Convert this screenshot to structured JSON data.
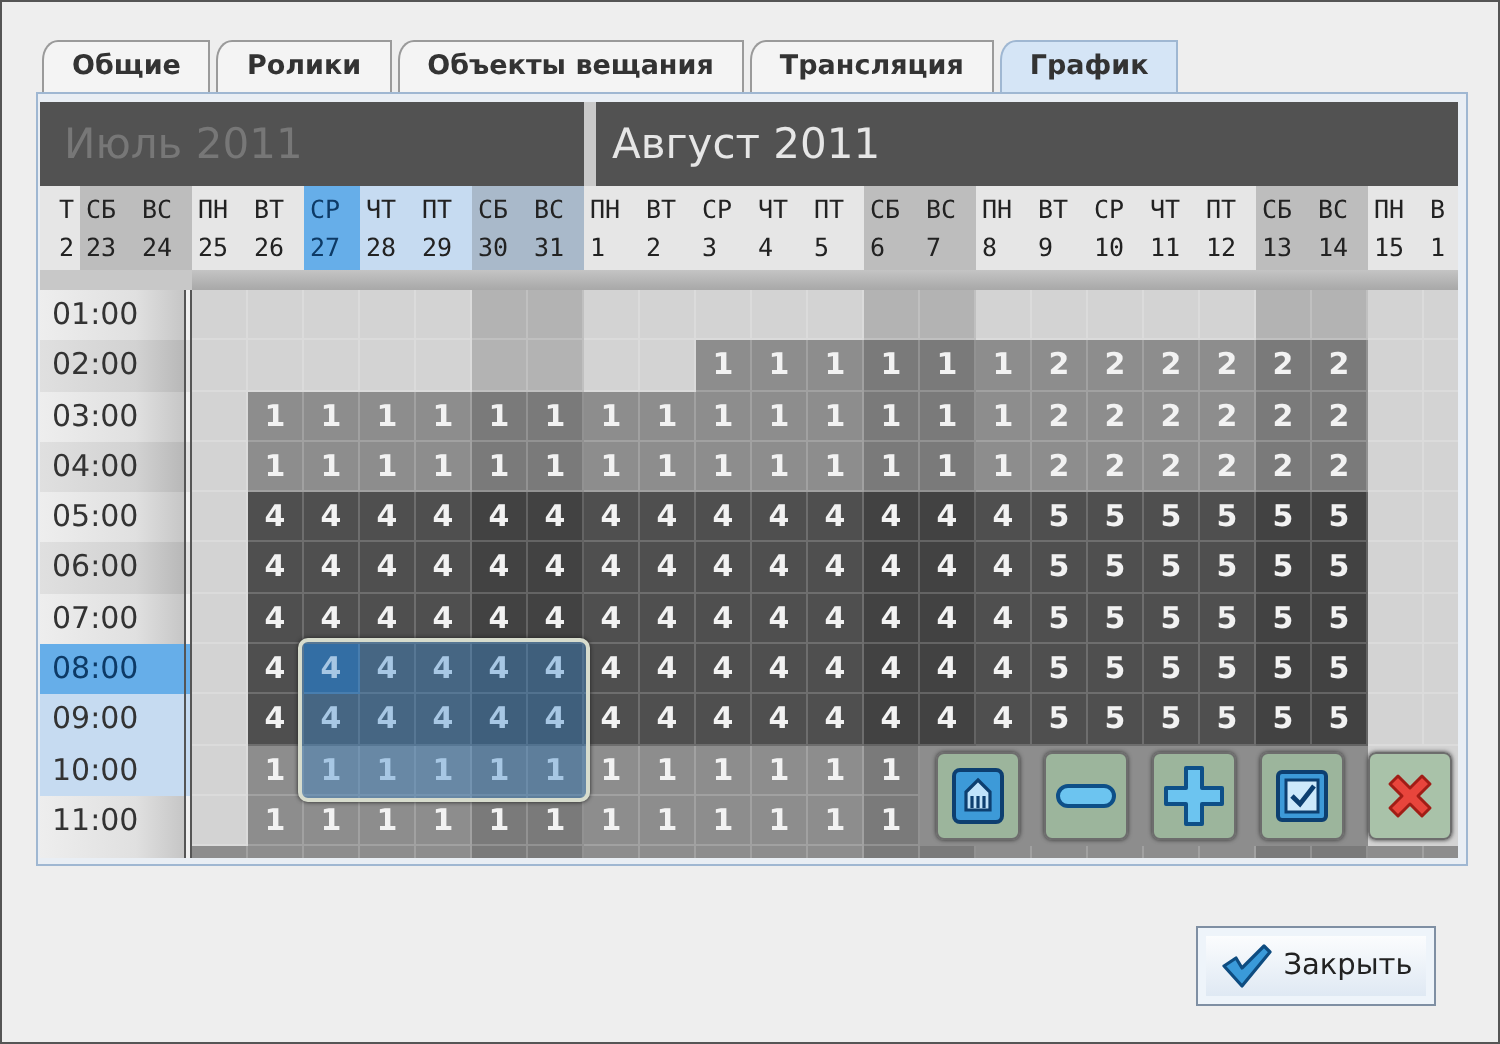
{
  "tabs": [
    {
      "label": "Общие",
      "selected": false
    },
    {
      "label": "Ролики",
      "selected": false
    },
    {
      "label": "Объекты вещания",
      "selected": false
    },
    {
      "label": "Трансляция",
      "selected": false
    },
    {
      "label": "График",
      "selected": true
    }
  ],
  "months": [
    {
      "name": "Июль 2011",
      "selected": false,
      "days": [
        {
          "weekday": "Т",
          "date": "2",
          "weekend": false,
          "selected": false,
          "cursor": false
        },
        {
          "weekday": "СБ",
          "date": "23",
          "weekend": true,
          "selected": false,
          "cursor": false
        },
        {
          "weekday": "ВС",
          "date": "24",
          "weekend": true,
          "selected": false,
          "cursor": false
        },
        {
          "weekday": "ПН",
          "date": "25",
          "weekend": false,
          "selected": false,
          "cursor": false
        },
        {
          "weekday": "ВТ",
          "date": "26",
          "weekend": false,
          "selected": false,
          "cursor": false
        },
        {
          "weekday": "СР",
          "date": "27",
          "weekend": false,
          "selected": true,
          "cursor": true
        },
        {
          "weekday": "ЧТ",
          "date": "28",
          "weekend": false,
          "selected": true,
          "cursor": false
        },
        {
          "weekday": "ПТ",
          "date": "29",
          "weekend": false,
          "selected": true,
          "cursor": false
        },
        {
          "weekday": "СБ",
          "date": "30",
          "weekend": true,
          "selected": true,
          "cursor": false
        },
        {
          "weekday": "ВС",
          "date": "31",
          "weekend": true,
          "selected": true,
          "cursor": false
        }
      ]
    },
    {
      "name": "Август 2011",
      "selected": true,
      "days": [
        {
          "weekday": "ПН",
          "date": "1",
          "weekend": false,
          "selected": false,
          "cursor": false
        },
        {
          "weekday": "ВТ",
          "date": "2",
          "weekend": false,
          "selected": false,
          "cursor": false
        },
        {
          "weekday": "СР",
          "date": "3",
          "weekend": false,
          "selected": false,
          "cursor": false
        },
        {
          "weekday": "ЧТ",
          "date": "4",
          "weekend": false,
          "selected": false,
          "cursor": false
        },
        {
          "weekday": "ПТ",
          "date": "5",
          "weekend": false,
          "selected": false,
          "cursor": false
        },
        {
          "weekday": "СБ",
          "date": "6",
          "weekend": true,
          "selected": false,
          "cursor": false
        },
        {
          "weekday": "ВС",
          "date": "7",
          "weekend": true,
          "selected": false,
          "cursor": false
        },
        {
          "weekday": "ПН",
          "date": "8",
          "weekend": false,
          "selected": false,
          "cursor": false
        },
        {
          "weekday": "ВТ",
          "date": "9",
          "weekend": false,
          "selected": false,
          "cursor": false
        },
        {
          "weekday": "СР",
          "date": "10",
          "weekend": false,
          "selected": false,
          "cursor": false
        },
        {
          "weekday": "ЧТ",
          "date": "11",
          "weekend": false,
          "selected": false,
          "cursor": false
        },
        {
          "weekday": "ПТ",
          "date": "12",
          "weekend": false,
          "selected": false,
          "cursor": false
        },
        {
          "weekday": "СБ",
          "date": "13",
          "weekend": true,
          "selected": false,
          "cursor": false
        },
        {
          "weekday": "ВС",
          "date": "14",
          "weekend": true,
          "selected": false,
          "cursor": false
        },
        {
          "weekday": "ПН",
          "date": "15",
          "weekend": false,
          "selected": false,
          "cursor": false
        },
        {
          "weekday": "В",
          "date": "1",
          "weekend": false,
          "selected": false,
          "cursor": false
        }
      ]
    }
  ],
  "rows": [
    {
      "time": "01:00",
      "selected": false,
      "cursor": false
    },
    {
      "time": "02:00",
      "kind": "mid",
      "selected": false,
      "cursor": false,
      "cells": [
        null,
        null,
        null,
        null,
        null,
        null,
        null,
        null,
        null,
        "1",
        "1",
        "1",
        "1",
        "1",
        "1",
        "2",
        "2",
        "2",
        "2",
        "2",
        "2"
      ]
    },
    {
      "time": "03:00",
      "kind": "mid",
      "selected": false,
      "cursor": false,
      "cells": [
        null,
        "1",
        "1",
        "1",
        "1",
        "1",
        "1",
        "1",
        "1",
        "1",
        "1",
        "1",
        "1",
        "1",
        "1",
        "2",
        "2",
        "2",
        "2",
        "2",
        "2"
      ]
    },
    {
      "time": "04:00",
      "kind": "mid",
      "selected": false,
      "cursor": false,
      "cells": [
        null,
        "1",
        "1",
        "1",
        "1",
        "1",
        "1",
        "1",
        "1",
        "1",
        "1",
        "1",
        "1",
        "1",
        "1",
        "2",
        "2",
        "2",
        "2",
        "2",
        "2"
      ]
    },
    {
      "time": "05:00",
      "kind": "dark",
      "selected": false,
      "cursor": false,
      "cells": [
        null,
        "4",
        "4",
        "4",
        "4",
        "4",
        "4",
        "4",
        "4",
        "4",
        "4",
        "4",
        "4",
        "4",
        "4",
        "5",
        "5",
        "5",
        "5",
        "5",
        "5"
      ]
    },
    {
      "time": "06:00",
      "kind": "dark",
      "selected": false,
      "cursor": false,
      "cells": [
        null,
        "4",
        "4",
        "4",
        "4",
        "4",
        "4",
        "4",
        "4",
        "4",
        "4",
        "4",
        "4",
        "4",
        "4",
        "5",
        "5",
        "5",
        "5",
        "5",
        "5"
      ]
    },
    {
      "time": "07:00",
      "kind": "dark",
      "selected": false,
      "cursor": false,
      "cells": [
        null,
        "4",
        "4",
        "4",
        "4",
        "4",
        "4",
        "4",
        "4",
        "4",
        "4",
        "4",
        "4",
        "4",
        "4",
        "5",
        "5",
        "5",
        "5",
        "5",
        "5"
      ]
    },
    {
      "time": "08:00",
      "kind": "dark",
      "selected": true,
      "cursor": true,
      "cells": [
        null,
        "4",
        "4",
        "4",
        "4",
        "4",
        "4",
        "4",
        "4",
        "4",
        "4",
        "4",
        "4",
        "4",
        "4",
        "5",
        "5",
        "5",
        "5",
        "5",
        "5"
      ]
    },
    {
      "time": "09:00",
      "kind": "dark",
      "selected": true,
      "cursor": false,
      "cells": [
        null,
        "4",
        "4",
        "4",
        "4",
        "4",
        "4",
        "4",
        "4",
        "4",
        "4",
        "4",
        "4",
        "4",
        "4",
        "5",
        "5",
        "5",
        "5",
        "5",
        "5"
      ]
    },
    {
      "time": "10:00",
      "kind": "mid",
      "selected": true,
      "cursor": false,
      "cells": [
        null,
        "1",
        "1",
        "1",
        "1",
        "1",
        "1",
        "1",
        "1",
        "1",
        "1",
        "1",
        "1"
      ]
    },
    {
      "time": "11:00",
      "kind": "mid",
      "selected": false,
      "cursor": false,
      "cells": [
        null,
        "1",
        "1",
        "1",
        "1",
        "1",
        "1",
        "1",
        "1",
        "1",
        "1",
        "1",
        "1"
      ]
    }
  ],
  "close_button": {
    "label": "Закрыть"
  }
}
